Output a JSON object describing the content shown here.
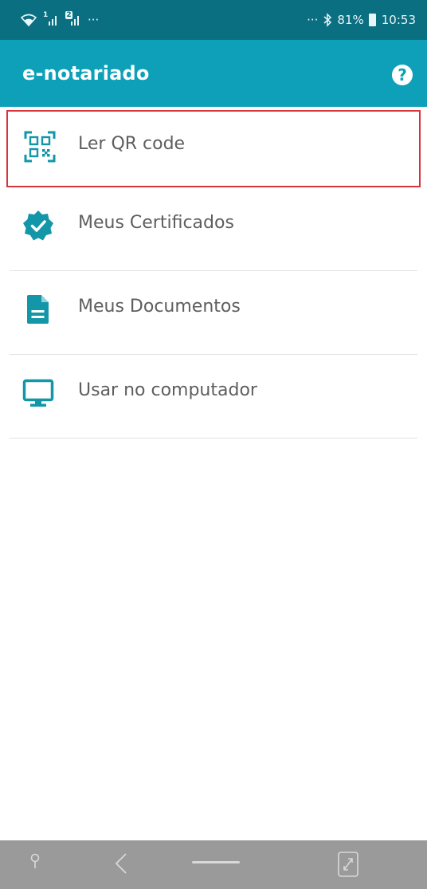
{
  "status_bar": {
    "sim1": "1",
    "sim2": "2",
    "overflow_left": "···",
    "overflow_right": "···",
    "battery_level": "81%",
    "time": "10:53"
  },
  "app_bar": {
    "title": "e-notariado",
    "help_glyph": "?"
  },
  "menu": {
    "items": [
      {
        "label": "Ler QR code",
        "icon": "qr-code-icon",
        "selected": true
      },
      {
        "label": "Meus Certificados",
        "icon": "verified-badge-icon",
        "selected": false
      },
      {
        "label": "Meus Documentos",
        "icon": "document-icon",
        "selected": false
      },
      {
        "label": "Usar no computador",
        "icon": "computer-monitor-icon",
        "selected": false
      }
    ]
  },
  "colors": {
    "status_bar": "#0b6f82",
    "app_bar": "#0da0b8",
    "icon_accent": "#1397a8",
    "selection_border": "#d6353d",
    "nav_bar": "#9a9a9a"
  }
}
